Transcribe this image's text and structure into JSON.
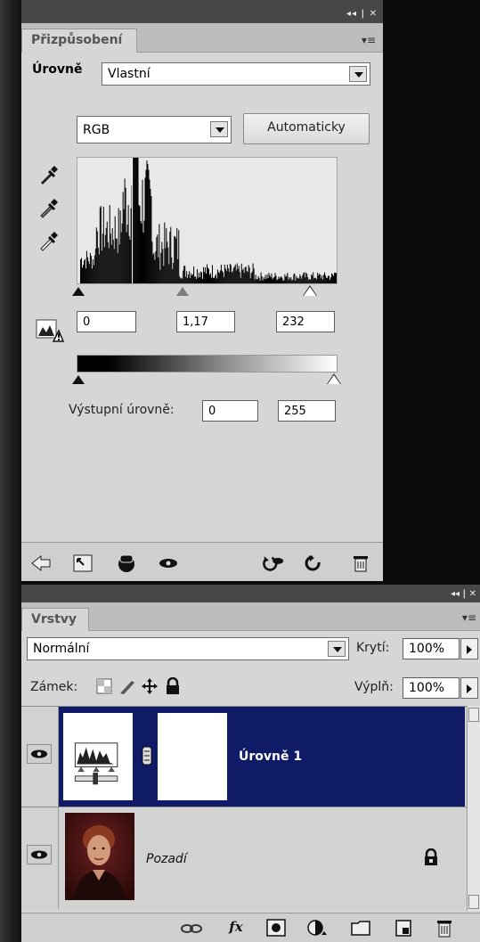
{
  "adjustments": {
    "tab_label": "Přizpůsobení",
    "adjustment_name": "Úrovně",
    "preset_value": "Vlastní",
    "channel_value": "RGB",
    "auto_button_label": "Automaticky",
    "input_levels": {
      "black": "0",
      "gamma": "1,17",
      "white": "232"
    },
    "output_label": "Výstupní úrovně:",
    "output_levels": {
      "black": "0",
      "white": "255"
    }
  },
  "layers": {
    "tab_label": "Vrstvy",
    "blend_mode": "Normální",
    "opacity_label": "Krytí:",
    "opacity_value": "100%",
    "lock_label": "Zámek:",
    "fill_label": "Výplň:",
    "fill_value": "100%",
    "items": [
      {
        "name": "Úrovně 1",
        "selected": true
      },
      {
        "name": "Pozadí",
        "selected": false
      }
    ],
    "footer_fx_label": "fx"
  },
  "colors": {
    "selected_layer": "#0f1b66",
    "panel_bg": "#d6d6d6",
    "titlebar": "#474747"
  }
}
